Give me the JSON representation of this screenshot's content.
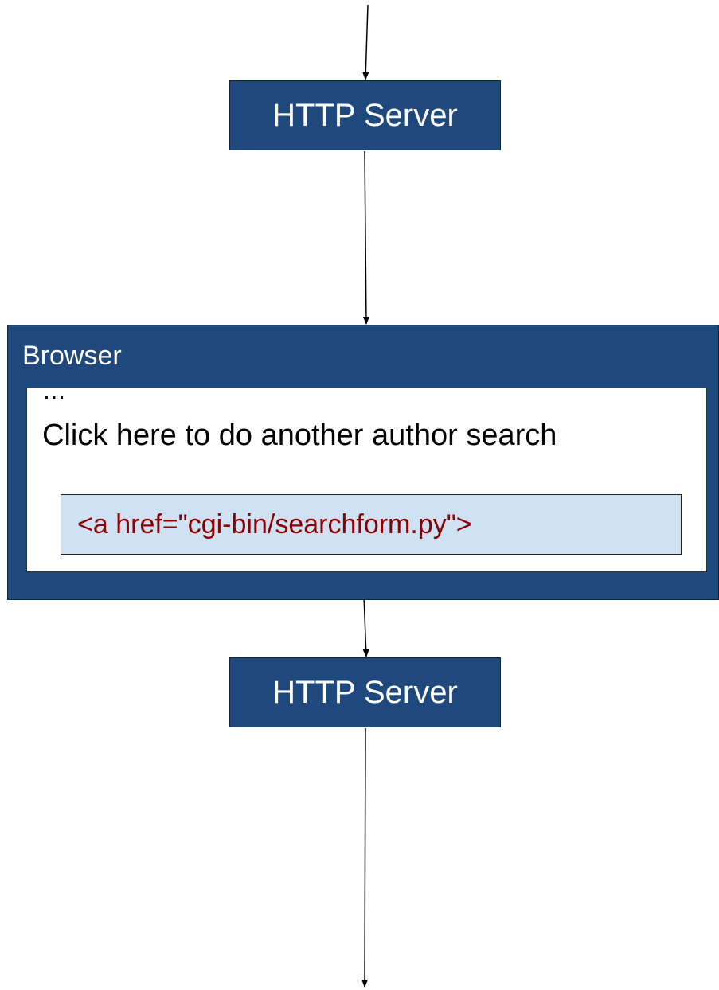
{
  "diagram": {
    "server_top_label": "HTTP Server",
    "server_bottom_label": "HTTP Server",
    "browser": {
      "title": "Browser",
      "ellipsis": "…",
      "link_text": "Click here to do another author search",
      "code": "<a href=\"cgi-bin/searchform.py\">"
    }
  },
  "colors": {
    "box_fill": "#1f497d",
    "box_text": "#ffffff",
    "code_fill": "#cfe2f3",
    "code_text": "#8b0000",
    "arrow": "#000000"
  }
}
